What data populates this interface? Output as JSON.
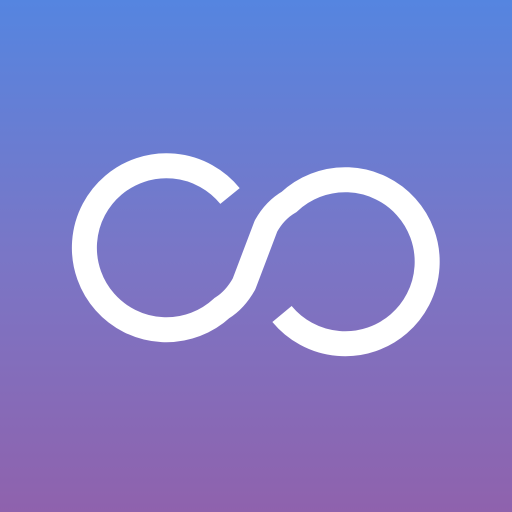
{
  "app_icon": {
    "icon": "infinity-icon",
    "colors": {
      "gradient_top": "#5585e0",
      "gradient_middle": "#7a76c6",
      "gradient_bottom": "#8f62ad",
      "glyph": "#ffffff"
    }
  }
}
